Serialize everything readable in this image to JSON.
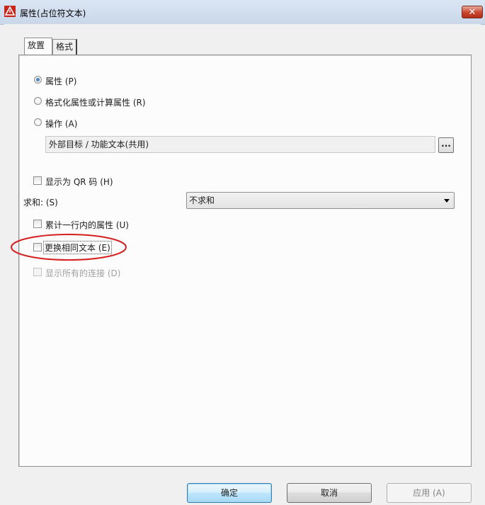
{
  "window": {
    "title": "属性(占位符文本)",
    "close_label": "✕"
  },
  "tabs": [
    {
      "label": "放置",
      "active": true
    },
    {
      "label": "格式",
      "active": false
    }
  ],
  "radios": [
    {
      "label": "属性 (P)",
      "checked": true
    },
    {
      "label": "格式化属性或计算属性 (R)",
      "checked": false
    },
    {
      "label": "操作 (A)",
      "checked": false
    }
  ],
  "action_field": {
    "value": "外部目标 / 功能文本(共用)"
  },
  "browse_button": {
    "label": "..."
  },
  "qr_checkbox": {
    "label": "显示为 QR 码 (H)",
    "checked": false
  },
  "sum": {
    "label": "求和: (S)",
    "selected": "不求和"
  },
  "checkboxes": [
    {
      "label": "累计一行内的属性 (U)",
      "checked": false,
      "enabled": true
    },
    {
      "label": "更换相同文本 (E)",
      "checked": false,
      "enabled": true
    },
    {
      "label": "显示所有的连接 (D)",
      "checked": false,
      "enabled": false
    }
  ],
  "annotation": {
    "color": "#d62020"
  },
  "buttons": {
    "ok": "确定",
    "cancel": "取消",
    "apply": "应用 (A)"
  },
  "colors": {
    "accent": "#3c7fb1",
    "titlebar": "#c9d7ea"
  }
}
